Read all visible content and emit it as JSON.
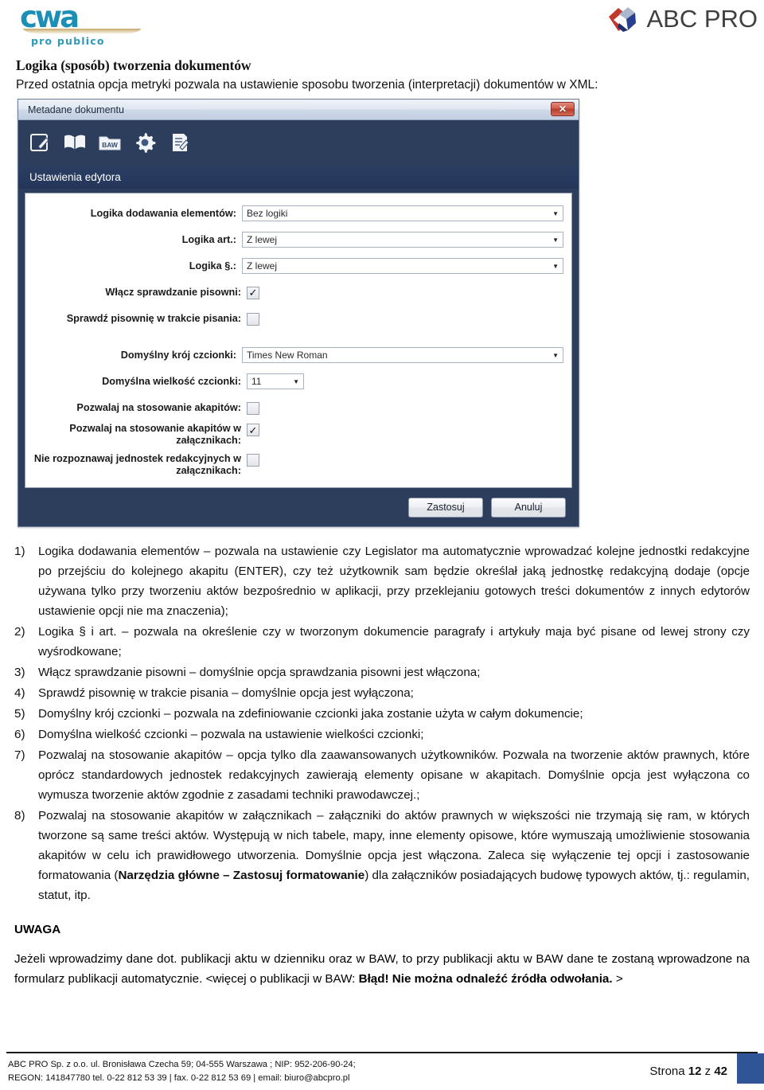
{
  "header": {
    "logo_left": {
      "name": "cwa-logo",
      "word": "cwa",
      "tagline": "pro publico"
    },
    "logo_right": {
      "name": "abc-pro-logo",
      "text": "ABC PRO"
    }
  },
  "title_block": {
    "heading": "Logika (sposób) tworzenia dokumentów",
    "subtitle": "Przed ostatnia opcja metryki pozwala na ustawienie sposobu tworzenia (interpretacji) dokumentów w XML:"
  },
  "dialog": {
    "titlebar": "Metadane dokumentu",
    "close_label": "✕",
    "toolbar_icons": [
      "edit-document-icon",
      "open-book-icon",
      "baw-folder-icon",
      "gear-icon",
      "document-edit-icon"
    ],
    "toolbar_icon_text": "BAW",
    "section_header": "Ustawienia edytora",
    "fields": [
      {
        "label": "Logika dodawania elementów:",
        "type": "combo",
        "value": "Bez logiki",
        "name": "logika-dodawania-elementow"
      },
      {
        "label": "Logika art.:",
        "type": "combo",
        "value": "Z lewej",
        "name": "logika-art"
      },
      {
        "label": "Logika §.:",
        "type": "combo",
        "value": "Z lewej",
        "name": "logika-paragraf"
      },
      {
        "label": "Włącz sprawdzanie pisowni:",
        "type": "checkbox",
        "checked": true,
        "name": "wlacz-sprawdzanie-pisowni"
      },
      {
        "label": "Sprawdź pisownię w trakcie pisania:",
        "type": "checkbox",
        "checked": false,
        "name": "sprawdz-pisownie-w-trakcie-pisania"
      },
      {
        "label": "Domyślny krój czcionki:",
        "type": "combo",
        "value": "Times New Roman",
        "name": "domyslny-kroj-czcionki"
      },
      {
        "label": "Domyślna wielkość czcionki:",
        "type": "combo-small",
        "value": "11",
        "name": "domyslna-wielkosc-czcionki"
      },
      {
        "label": "Pozwalaj na stosowanie akapitów:",
        "type": "checkbox",
        "checked": false,
        "name": "pozwalaj-na-stosowanie-akapitow"
      },
      {
        "label": "Pozwalaj na stosowanie akapitów w załącznikach:",
        "type": "checkbox",
        "checked": true,
        "name": "pozwalaj-na-stosowanie-akapitow-w-zalacznikach"
      },
      {
        "label": "Nie rozpoznawaj jednostek redakcyjnych w załącznikach:",
        "type": "checkbox",
        "checked": false,
        "name": "nie-rozpoznawaj-jednostek-redakcyjnych"
      }
    ],
    "check_glyph": "✓",
    "caret_glyph": "▼",
    "buttons": {
      "apply": "Zastosuj",
      "cancel": "Anuluj"
    }
  },
  "list_items": [
    {
      "num": "1)",
      "text": "Logika dodawania elementów – pozwala na ustawienie czy Legislator ma automatycznie wprowadzać kolejne jednostki redakcyjne po przejściu do kolejnego akapitu (ENTER), czy też użytkownik sam będzie określał jaką jednostkę redakcyjną dodaje (opcje używana tylko przy tworzeniu aktów bezpośrednio w aplikacji, przy przeklejaniu gotowych treści dokumentów z innych edytorów ustawienie opcji nie ma znaczenia);"
    },
    {
      "num": "2)",
      "text": "Logika § i art. –  pozwala na określenie czy w tworzonym dokumencie paragrafy i artykuły maja być pisane od lewej strony czy wyśrodkowane;"
    },
    {
      "num": "3)",
      "text": "Włącz sprawdzanie pisowni – domyślnie opcja sprawdzania pisowni jest włączona;"
    },
    {
      "num": "4)",
      "text": "Sprawdź pisownię w trakcie pisania – domyślnie opcja jest wyłączona;"
    },
    {
      "num": "5)",
      "text": "Domyślny krój czcionki – pozwala na zdefiniowanie czcionki jaka zostanie użyta w całym dokumencie;"
    },
    {
      "num": "6)",
      "text": "Domyślna wielkość czcionki – pozwala na ustawienie wielkości czcionki;"
    },
    {
      "num": "7)",
      "text": "Pozwalaj na stosowanie akapitów – opcja tylko dla zaawansowanych użytkowników. Pozwala na tworzenie aktów prawnych, które oprócz standardowych jednostek redakcyjnych zawierają elementy opisane w akapitach. Domyślnie opcja jest wyłączona co wymusza tworzenie aktów zgodnie z zasadami techniki prawodawczej.;"
    },
    {
      "num": "8)",
      "text_before": "Pozwalaj na stosowanie akapitów w załącznikach – załączniki do aktów prawnych w większości nie trzymają się ram, w których tworzone są same treści aktów. Występują w nich tabele, mapy, inne elementy opisowe, które wymuszają umożliwienie stosowania akapitów w celu ich prawidłowego utworzenia. Domyślnie opcja jest włączona. Zaleca się wyłączenie tej opcji i zastosowanie formatowania (",
      "bold": "Narzędzia główne – Zastosuj formatowanie",
      "text_after": ") dla załączników posiadających budowę typowych aktów, tj.: regulamin, statut, itp."
    }
  ],
  "uwaga": {
    "heading": "UWAGA",
    "text_before": "Jeżeli wprowadzimy dane dot. publikacji aktu w dzienniku oraz w BAW, to przy publikacji aktu w BAW dane te zostaną wprowadzone na formularz publikacji automatycznie. <więcej o publikacji w BAW: ",
    "bold": "Błąd! Nie można odnaleźć źródła odwołania.",
    "text_after": " >"
  },
  "footer": {
    "line1": "ABC PRO Sp. z o.o. ul. Bronisława Czecha 59;  04-555 Warszawa ; NIP: 952-206-90-24;",
    "line2": "REGON: 141847780 tel. 0-22 812 53 39 | fax. 0-22 812 53 69 | email: biuro@abcpro.pl",
    "page_prefix": "Strona ",
    "page_current": "12",
    "page_mid": " z ",
    "page_total": "42",
    "accent_color": "#2f5597"
  }
}
